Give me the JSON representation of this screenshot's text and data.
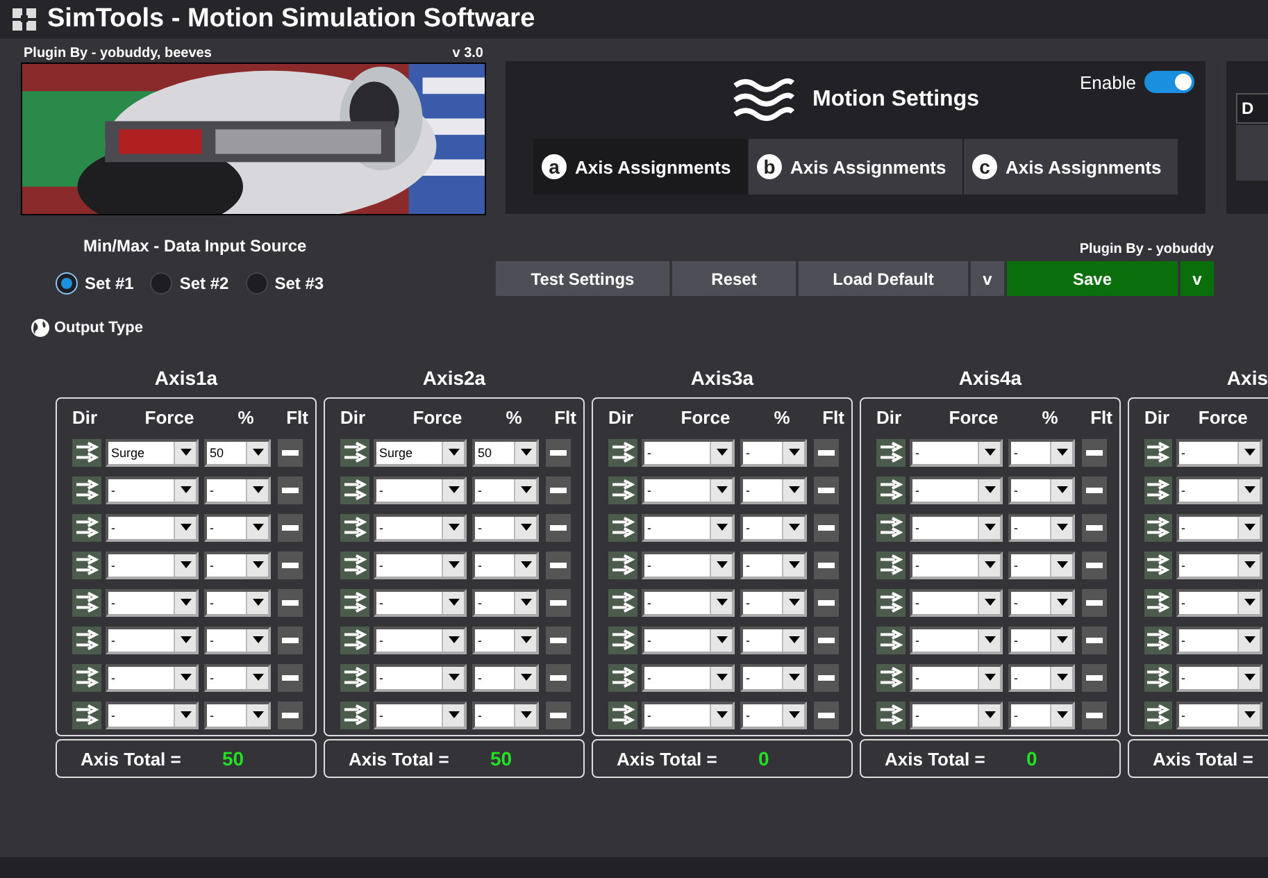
{
  "window": {
    "title": "SimTools - Motion Simulation Software"
  },
  "plugin": {
    "credit": "Plugin By - yobuddy, beeves",
    "version": "v 3.0"
  },
  "motion": {
    "title": "Motion Settings",
    "enable": {
      "label": "Enable",
      "on": true
    },
    "tabs": [
      {
        "letter": "a",
        "label": "Axis Assignments",
        "selected": true
      },
      {
        "letter": "b",
        "label": "Axis Assignments",
        "selected": false
      },
      {
        "letter": "c",
        "label": "Axis Assignments",
        "selected": false
      }
    ]
  },
  "side_panel": {
    "field": "D"
  },
  "input_source": {
    "title": "Min/Max - Data Input Source",
    "options": [
      {
        "label": "Set #1",
        "selected": true
      },
      {
        "label": "Set #2",
        "selected": false
      },
      {
        "label": "Set #3",
        "selected": false
      }
    ]
  },
  "actions": {
    "credit": "Plugin By - yobuddy",
    "buttons": [
      {
        "kind": "plain",
        "label": "Test Settings"
      },
      {
        "kind": "plain",
        "label": "Reset"
      },
      {
        "kind": "plain",
        "label": "Load Default"
      },
      {
        "kind": "menu",
        "label": "v"
      },
      {
        "kind": "save",
        "label": "Save"
      },
      {
        "kind": "savemenu",
        "label": "v"
      }
    ]
  },
  "output_type": {
    "label": "Output Type"
  },
  "axes": [
    {
      "title": "Axis1a",
      "headers": [
        "Dir",
        "Force",
        "%",
        "Flt"
      ],
      "rows": [
        {
          "force": "Surge",
          "percent": "50"
        },
        {
          "force": "-",
          "percent": "-"
        },
        {
          "force": "-",
          "percent": "-"
        },
        {
          "force": "-",
          "percent": "-"
        },
        {
          "force": "-",
          "percent": "-"
        },
        {
          "force": "-",
          "percent": "-"
        },
        {
          "force": "-",
          "percent": "-"
        },
        {
          "force": "-",
          "percent": "-"
        }
      ],
      "total_label": "Axis Total =",
      "total": "50"
    },
    {
      "title": "Axis2a",
      "headers": [
        "Dir",
        "Force",
        "%",
        "Flt"
      ],
      "rows": [
        {
          "force": "Surge",
          "percent": "50"
        },
        {
          "force": "-",
          "percent": "-"
        },
        {
          "force": "-",
          "percent": "-"
        },
        {
          "force": "-",
          "percent": "-"
        },
        {
          "force": "-",
          "percent": "-"
        },
        {
          "force": "-",
          "percent": "-"
        },
        {
          "force": "-",
          "percent": "-"
        },
        {
          "force": "-",
          "percent": "-"
        }
      ],
      "total_label": "Axis Total =",
      "total": "50"
    },
    {
      "title": "Axis3a",
      "headers": [
        "Dir",
        "Force",
        "%",
        "Flt"
      ],
      "rows": [
        {
          "force": "-",
          "percent": "-"
        },
        {
          "force": "-",
          "percent": "-"
        },
        {
          "force": "-",
          "percent": "-"
        },
        {
          "force": "-",
          "percent": "-"
        },
        {
          "force": "-",
          "percent": "-"
        },
        {
          "force": "-",
          "percent": "-"
        },
        {
          "force": "-",
          "percent": "-"
        },
        {
          "force": "-",
          "percent": "-"
        }
      ],
      "total_label": "Axis Total =",
      "total": "0"
    },
    {
      "title": "Axis4a",
      "headers": [
        "Dir",
        "Force",
        "%",
        "Flt"
      ],
      "rows": [
        {
          "force": "-",
          "percent": "-"
        },
        {
          "force": "-",
          "percent": "-"
        },
        {
          "force": "-",
          "percent": "-"
        },
        {
          "force": "-",
          "percent": "-"
        },
        {
          "force": "-",
          "percent": "-"
        },
        {
          "force": "-",
          "percent": "-"
        },
        {
          "force": "-",
          "percent": "-"
        },
        {
          "force": "-",
          "percent": "-"
        }
      ],
      "total_label": "Axis Total =",
      "total": "0"
    },
    {
      "title": "Axis",
      "headers": [
        "Dir",
        "Force"
      ],
      "rows": [
        {
          "force": "-"
        },
        {
          "force": "-"
        },
        {
          "force": "-"
        },
        {
          "force": "-"
        },
        {
          "force": "-"
        },
        {
          "force": "-"
        },
        {
          "force": "-"
        },
        {
          "force": "-"
        }
      ],
      "total_label": "Axis Total ="
    }
  ]
}
